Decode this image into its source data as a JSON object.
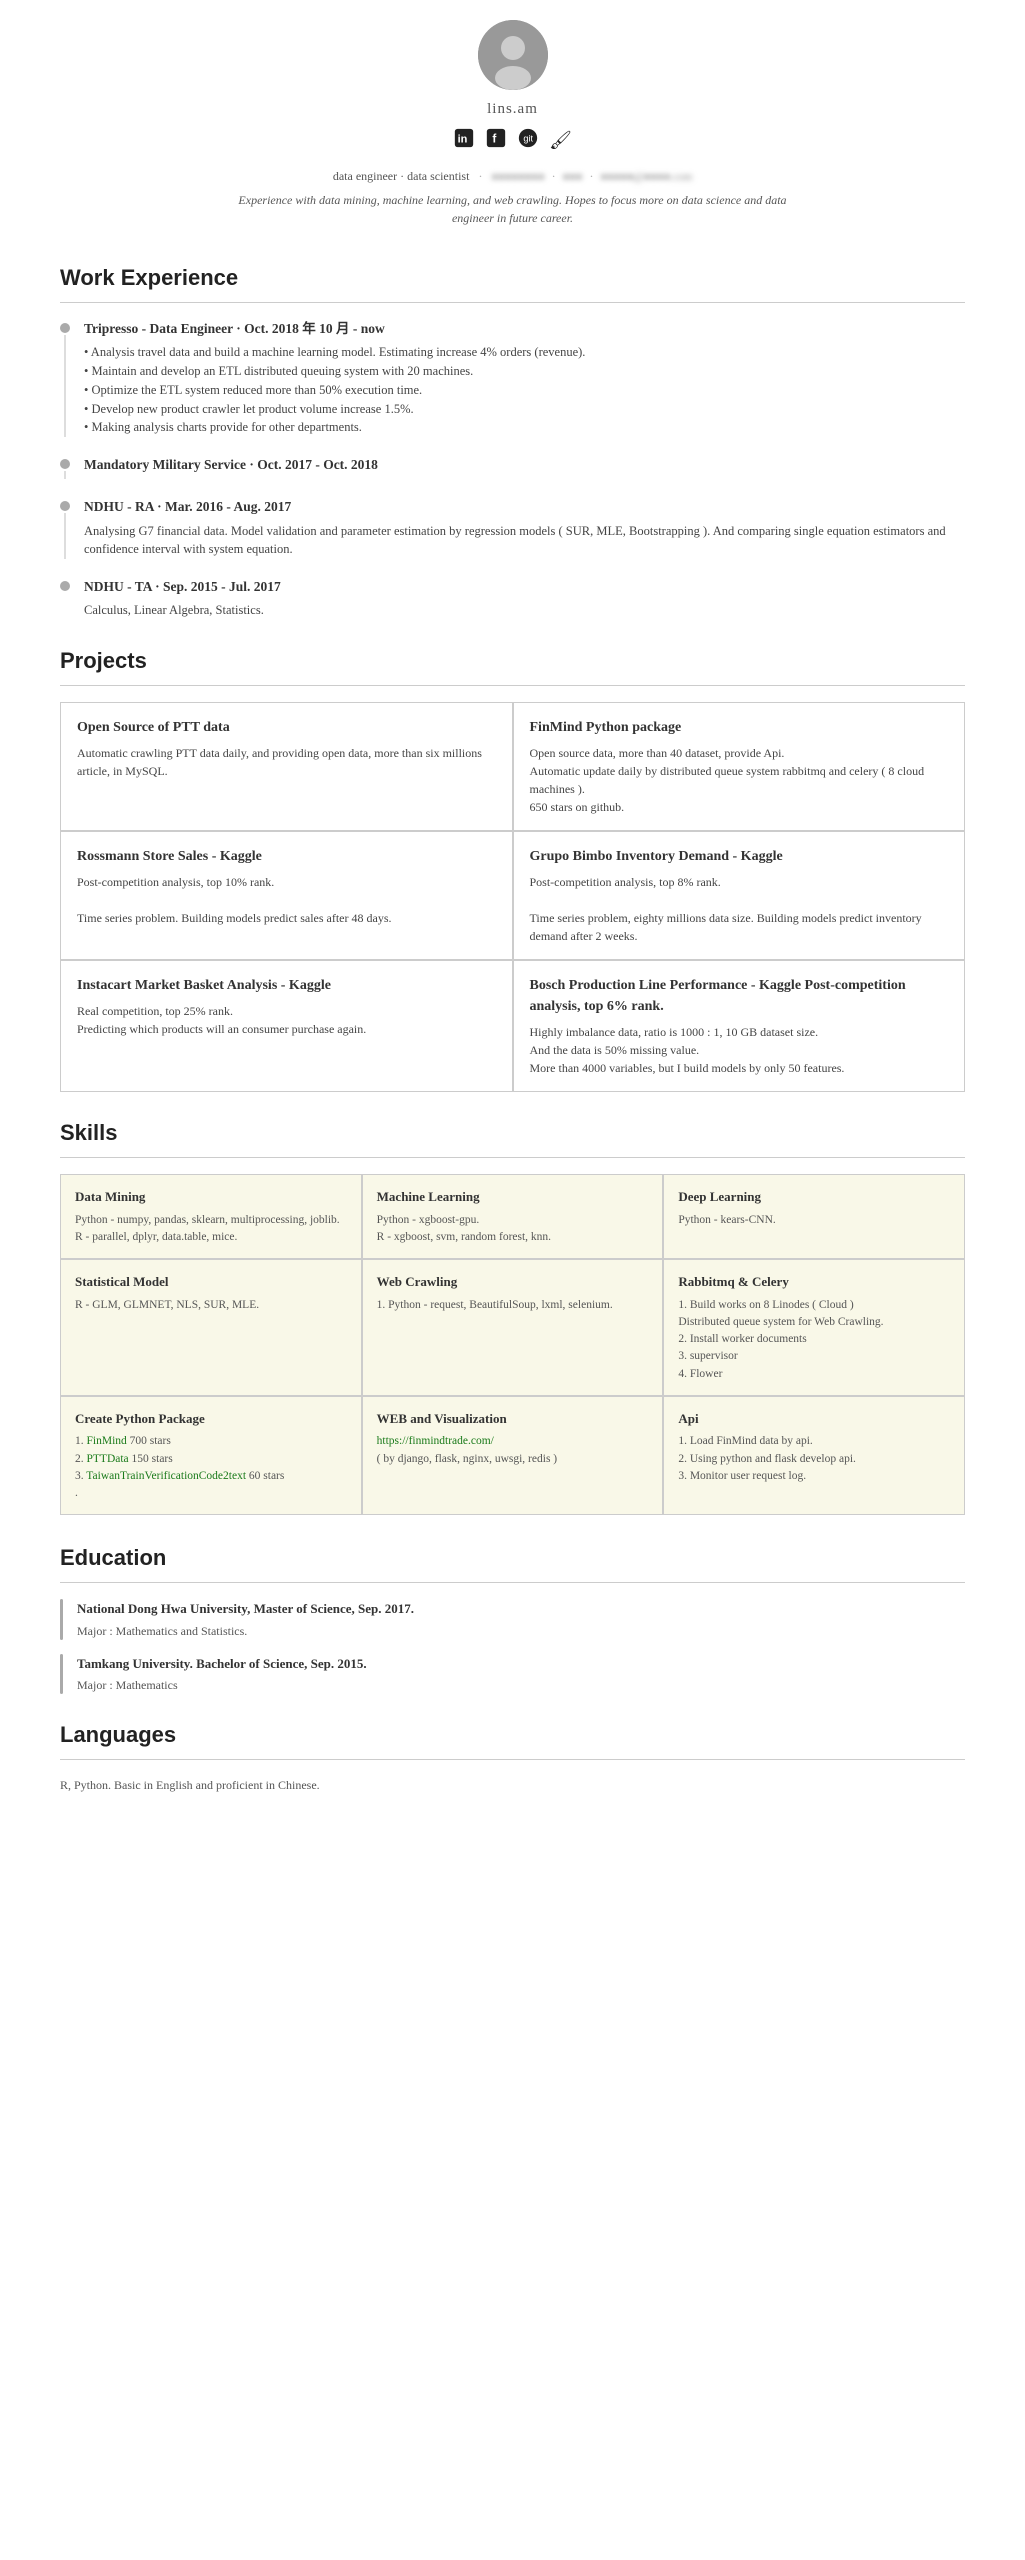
{
  "profile": {
    "name": "lins.am",
    "title": "data engineer · data scientist",
    "phone_blurred": "●●●●●●●●",
    "email_blurred": "●●●●@●●●●.com",
    "bio": "Experience with data mining, machine learning, and web crawling. Hopes to focus more on data science and data engineer in future career.",
    "social": [
      "linkedin",
      "facebook",
      "github",
      "blog"
    ]
  },
  "sections": {
    "work_experience": {
      "title": "Work Experience",
      "items": [
        {
          "title": "Tripresso - Data Engineer · Oct. 2018 年 10 月 - now",
          "desc": "• Analysis travel data and build a machine learning model. Estimating increase 4% orders (revenue).\n• Maintain and develop an ETL distributed queuing system with 20 machines.\n• Optimize the ETL system reduced more than 50% execution time.\n• Develop new product crawler let product volume increase 1.5%.\n• Making analysis charts provide for other departments."
        },
        {
          "title": "Mandatory Military Service · Oct. 2017 - Oct. 2018",
          "desc": ""
        },
        {
          "title": "NDHU - RA · Mar. 2016 - Aug. 2017",
          "desc": "Analysing G7 financial data. Model validation and parameter estimation by regression models ( SUR, MLE, Bootstrapping ). And comparing single equation estimators and confidence interval with system equation."
        },
        {
          "title": "NDHU - TA · Sep. 2015 - Jul. 2017",
          "desc": "Calculus, Linear Algebra, Statistics."
        }
      ]
    },
    "projects": {
      "title": "Projects",
      "items": [
        {
          "name": "Open Source of PTT data",
          "desc": "Automatic crawling PTT data daily, and providing open data, more than six millions article, in MySQL."
        },
        {
          "name": "FinMind Python package",
          "desc": "Open source data, more than 40 dataset, provide Api.\nAutomatic update daily by distributed queue system rabbitmq and celery ( 8 cloud machines ).\n650 stars on github."
        },
        {
          "name": "Rossmann Store Sales - Kaggle",
          "desc": "Post-competition analysis, top 10% rank.\n\nTime series problem. Building models predict sales after 48 days."
        },
        {
          "name": "Grupo Bimbo Inventory Demand - Kaggle",
          "desc": "Post-competition analysis, top 8% rank.\n\nTime series problem, eighty millions data size. Building models predict inventory demand after 2 weeks."
        },
        {
          "name": "Instacart Market Basket Analysis - Kaggle",
          "desc": "Real competition, top 25% rank.\nPredicting which products will an consumer purchase again."
        },
        {
          "name": "Bosch Production Line Performance - Kaggle Post-competition analysis, top 6% rank.",
          "desc": "Highly imbalance data, ratio is 1000 : 1, 10 GB dataset size.\nAnd the data is 50% missing value.\nMore than 4000 variables, but I build models by only 50 features."
        }
      ]
    },
    "skills": {
      "title": "Skills",
      "items": [
        {
          "name": "Data Mining",
          "desc": "Python - numpy, pandas, sklearn, multiprocessing, joblib.\nR - parallel, dplyr, data.table, mice."
        },
        {
          "name": "Machine Learning",
          "desc": "Python - xgboost-gpu.\nR - xgboost, svm, random forest, knn."
        },
        {
          "name": "Deep Learning",
          "desc": "Python - kears-CNN."
        },
        {
          "name": "Statistical Model",
          "desc": "R - GLM, GLMNET, NLS, SUR, MLE."
        },
        {
          "name": "Web Crawling",
          "desc": "1. Python - request, BeautifulSoup, lxml, selenium."
        },
        {
          "name": "Rabbitmq & Celery",
          "desc": "1. Build works on 8 Linodes ( Cloud )\nDistributed queue system for Web Crawling.\n2. Install worker documents\n3. supervisor\n4. Flower"
        },
        {
          "name": "Create Python Package",
          "desc": "1. FinMind 700 stars\n2. PTTData 150 stars\n3. TaiwanTrainVerificationCode2text 60 stars\n."
        },
        {
          "name": "WEB and Visualization",
          "desc_link": "https://finmindtrade.com/",
          "desc_after": "( by django, flask, nginx, uwsgi, redis )"
        },
        {
          "name": "Api",
          "desc": "1. Load FinMind data by api.\n2. Using python and flask develop api.\n3. Monitor user request log."
        }
      ]
    },
    "education": {
      "title": "Education",
      "items": [
        {
          "title": "National Dong Hwa University, Master of Science,  Sep. 2017.",
          "sub": "Major : Mathematics and Statistics."
        },
        {
          "title": "Tamkang University. Bachelor of Science, Sep. 2015.",
          "sub": "Major : Mathematics"
        }
      ]
    },
    "languages": {
      "title": "Languages",
      "desc": "R, Python. Basic in English and proficient in Chinese."
    }
  }
}
